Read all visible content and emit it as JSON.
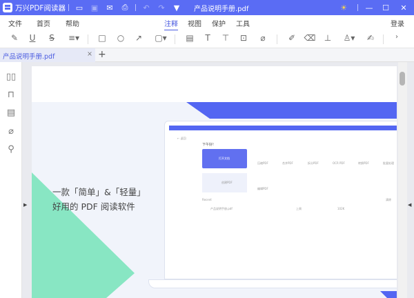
{
  "titlebar": {
    "app_name": "万兴PDF阅读器",
    "document_title": "产品说明手册.pdf",
    "icons": [
      "folder-icon",
      "save-icon",
      "mail-icon",
      "print-icon",
      "undo-icon",
      "redo-icon",
      "dropdown-icon",
      "theme-sun-icon",
      "minimize-icon",
      "maximize-icon",
      "close-icon"
    ]
  },
  "menubar": {
    "items": [
      "文件",
      "首页",
      "帮助"
    ],
    "tabs": [
      "注释",
      "视图",
      "保护",
      "工具"
    ],
    "active_tab": "注释",
    "login": "登录"
  },
  "tabbar": {
    "tab_label": "产品说明手册.pdf",
    "close": "×",
    "add": "+"
  },
  "page": {
    "headline_line1": "一款「简单」&「轻量」",
    "headline_line2": "好用的 PDF 阅读软件",
    "mock": {
      "greeting": "下午好!",
      "back": "← 返回",
      "open": "打开文档",
      "create": "创建PDF",
      "tools": [
        "压缩PDF",
        "合并PDF",
        "拆分PDF",
        "OCR PDF",
        "转换PDF",
        "批量处理"
      ],
      "edit": "编辑PDF",
      "recent": "Recent",
      "file": "产品说明手册.pdf",
      "when": "上周",
      "size": "102K",
      "clear": "清除"
    }
  },
  "colors": {
    "brand": "#5a6cf4",
    "green": "#88e6c3",
    "page_bg": "#f1f4fb"
  }
}
